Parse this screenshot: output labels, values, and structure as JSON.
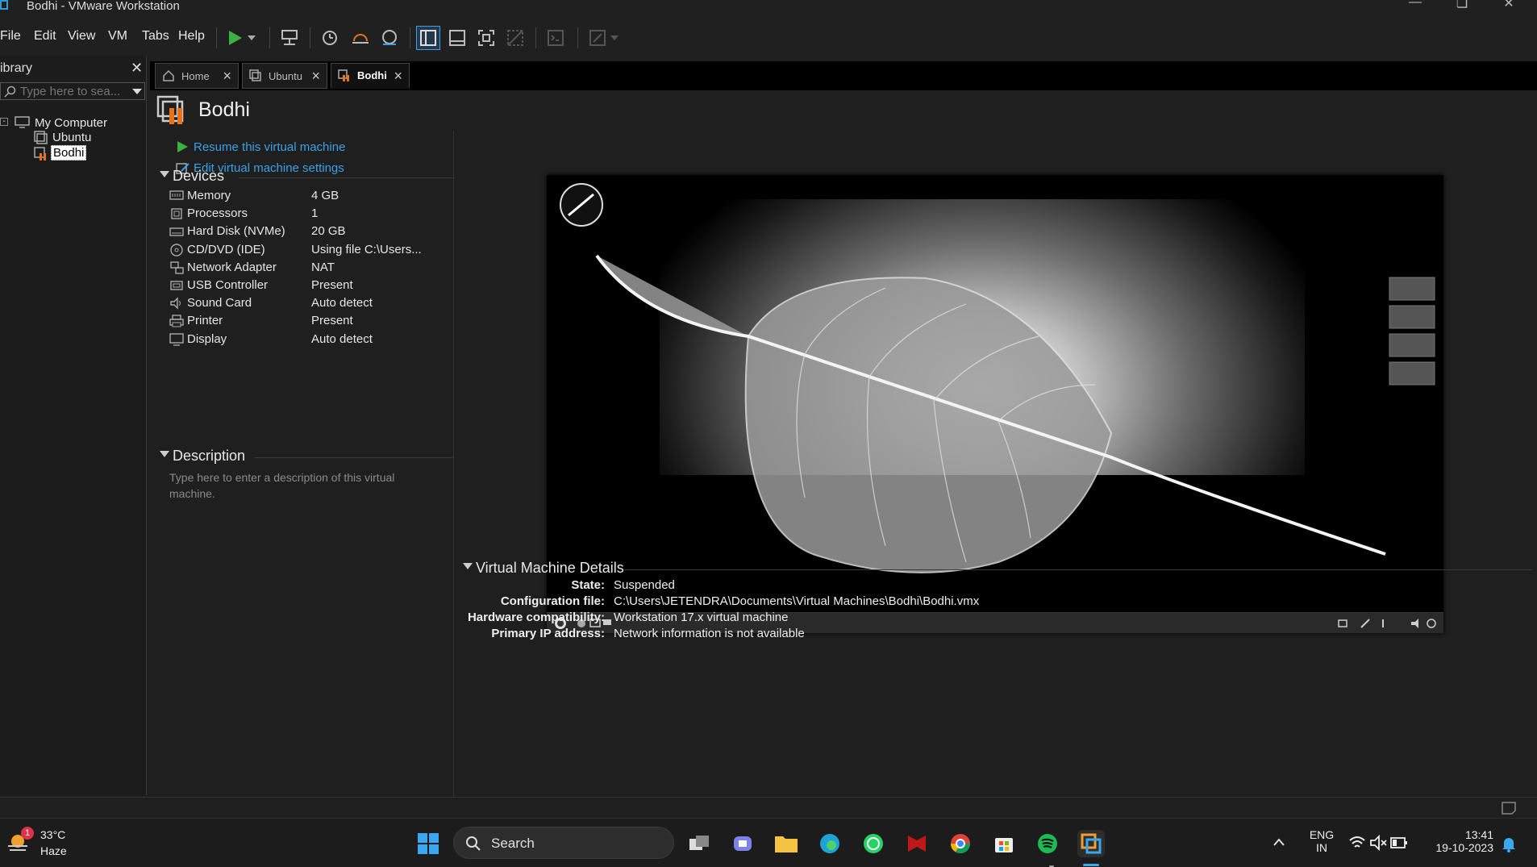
{
  "window": {
    "title": "Bodhi - VMware Workstation"
  },
  "menu": [
    "File",
    "Edit",
    "View",
    "VM",
    "Tabs",
    "Help"
  ],
  "library": {
    "title": "Library",
    "title_visible": "ibrary",
    "search_placeholder": "Type here to sea...",
    "tree": {
      "root": "My Computer",
      "children": [
        "Ubuntu",
        "Bodhi"
      ],
      "selected": "Bodhi"
    }
  },
  "tabs": [
    {
      "label": "Home",
      "active": false
    },
    {
      "label": "Ubuntu",
      "active": false
    },
    {
      "label": "Bodhi",
      "active": true
    }
  ],
  "vm": {
    "name": "Bodhi",
    "actions": [
      "Resume this virtual machine",
      "Edit virtual machine settings"
    ],
    "devices_title": "Devices",
    "devices": [
      {
        "name": "Memory",
        "value": "4 GB",
        "icon": "memory-icon"
      },
      {
        "name": "Processors",
        "value": "1",
        "icon": "processor-icon"
      },
      {
        "name": "Hard Disk (NVMe)",
        "value": "20 GB",
        "icon": "hard-disk-icon"
      },
      {
        "name": "CD/DVD (IDE)",
        "value": "Using file C:\\Users...",
        "icon": "cd-dvd-icon"
      },
      {
        "name": "Network Adapter",
        "value": "NAT",
        "icon": "network-adapter-icon"
      },
      {
        "name": "USB Controller",
        "value": "Present",
        "icon": "usb-controller-icon"
      },
      {
        "name": "Sound Card",
        "value": "Auto detect",
        "icon": "sound-card-icon"
      },
      {
        "name": "Printer",
        "value": "Present",
        "icon": "printer-icon"
      },
      {
        "name": "Display",
        "value": "Auto detect",
        "icon": "display-icon"
      }
    ],
    "description_title": "Description",
    "description_placeholder": "Type here to enter a description of this virtual machine.",
    "details_title": "Virtual Machine Details",
    "details": [
      {
        "label": "State:",
        "value": "Suspended"
      },
      {
        "label": "Configuration file:",
        "value": "C:\\Users\\JETENDRA\\Documents\\Virtual Machines\\Bodhi\\Bodhi.vmx"
      },
      {
        "label": "Hardware compatibility:",
        "value": "Workstation 17.x virtual machine"
      },
      {
        "label": "Primary IP address:",
        "value": "Network information is not available"
      }
    ]
  },
  "taskbar": {
    "weather": {
      "temp": "33°C",
      "condition": "Haze",
      "badge": "1"
    },
    "search_label": "Search",
    "apps": [
      "start",
      "task-view",
      "teams",
      "file-explorer",
      "edge",
      "whatsapp",
      "mcafee",
      "chrome",
      "store",
      "spotify",
      "vmware"
    ],
    "language": {
      "line1": "ENG",
      "line2": "IN"
    },
    "time": "13:41",
    "date": "19-10-2023"
  },
  "colors": {
    "accent": "#3aa0e8",
    "play_green": "#3cb043",
    "vm_icon_orange": "#e8711c"
  }
}
